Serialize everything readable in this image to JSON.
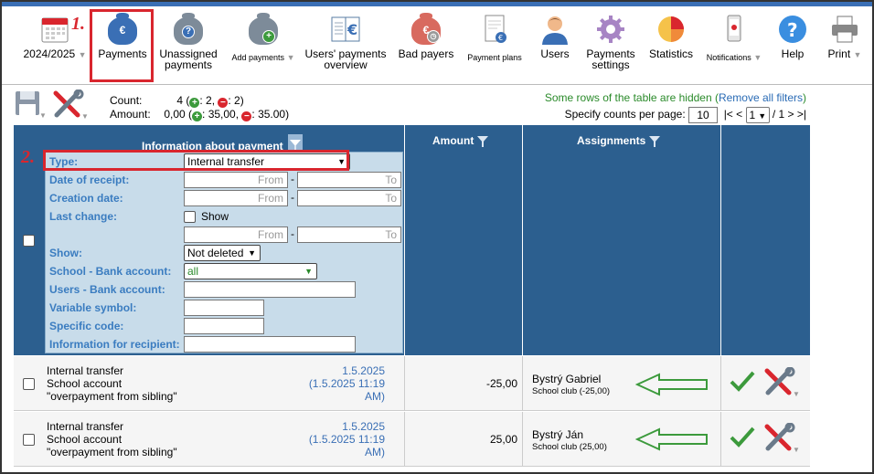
{
  "toolbar": {
    "year": "2024/2025",
    "payments": "Payments",
    "unassigned": "Unassigned payments",
    "add_payments": "Add payments",
    "users_overview": "Users' payments overview",
    "bad_payers": "Bad payers",
    "payment_plans": "Payment plans",
    "users": "Users",
    "payments_settings": "Payments settings",
    "statistics": "Statistics",
    "notifications": "Notifications",
    "help": "Help",
    "print": "Print"
  },
  "steps": {
    "one": "1.",
    "two": "2."
  },
  "summary": {
    "count_label": "Count:",
    "count_value": "4 (",
    "count_plus": ": 2,",
    "count_minus": ": 2)",
    "amount_label": "Amount:",
    "amount_value": "0,00 (",
    "amount_plus": ": 35,00,",
    "amount_minus": ": 35.00)"
  },
  "notice": {
    "hidden_text": "Some rows of the table are hidden (",
    "remove_link": "Remove all filters",
    "close_paren": ")",
    "per_page_label": "Specify counts per page:",
    "per_page_value": "10",
    "pager_prev": "|< <",
    "page_selected": "1",
    "page_total": "/ 1",
    "pager_next": "> >|"
  },
  "table": {
    "col_info": "Information about payment",
    "col_amount": "Amount",
    "col_assignments": "Assignments"
  },
  "filters": {
    "type_label": "Type:",
    "type_value": "Internal transfer",
    "receipt_label": "Date of receipt:",
    "creation_label": "Creation date:",
    "lastchange_label": "Last change:",
    "show_checkbox_label": "Show",
    "show_label": "Show:",
    "show_value": "Not deleted",
    "school_bank_label": "School - Bank account:",
    "school_bank_value": "all",
    "users_bank_label": "Users - Bank account:",
    "variable_label": "Variable symbol:",
    "specific_label": "Specific code:",
    "recipient_label": "Information for recipient:",
    "from_placeholder": "From",
    "to_placeholder": "To",
    "dash": "-"
  },
  "rows": [
    {
      "line1": "Internal transfer",
      "line2": "School account",
      "line3": "\"overpayment from sibling\"",
      "date": "1.5.2025",
      "datetime": "(1.5.2025 11:19 AM)",
      "amount": "-25,00",
      "person": "Bystrý Gabriel",
      "club": "School club (-25,00)"
    },
    {
      "line1": "Internal transfer",
      "line2": "School account",
      "line3": "\"overpayment from sibling\"",
      "date": "1.5.2025",
      "datetime": "(1.5.2025 11:19 AM)",
      "amount": "25,00",
      "person": "Bystrý Ján",
      "club": "School club (25,00)"
    }
  ]
}
